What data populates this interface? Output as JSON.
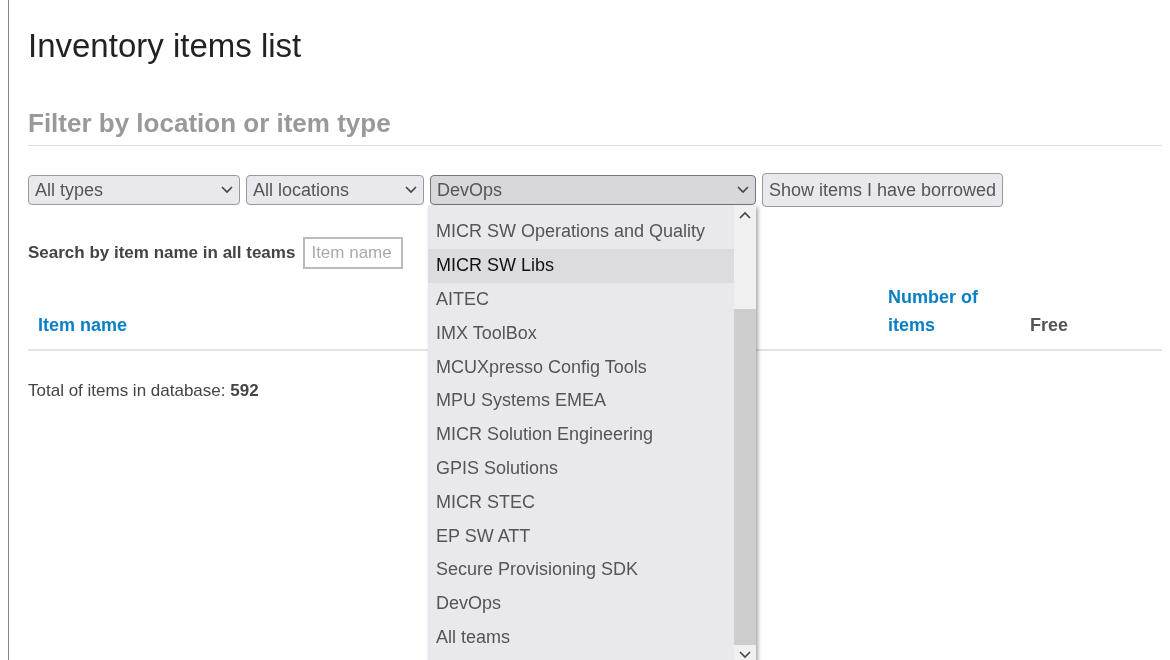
{
  "title": "Inventory items list",
  "filter_heading": "Filter by location or item type",
  "selects": [
    {
      "value": "All types",
      "open": false
    },
    {
      "value": "All locations",
      "open": false
    },
    {
      "value": "DevOps",
      "open": true
    }
  ],
  "borrowed_button": "Show items I have borrowed",
  "dropdown_options": [
    {
      "label": "MICR SW Operations and Quality",
      "selected": false
    },
    {
      "label": "MICR SW Libs",
      "selected": true
    },
    {
      "label": "AITEC",
      "selected": false
    },
    {
      "label": "IMX ToolBox",
      "selected": false
    },
    {
      "label": "MCUXpresso Config Tools",
      "selected": false
    },
    {
      "label": "MPU Systems EMEA",
      "selected": false
    },
    {
      "label": "MICR Solution Engineering",
      "selected": false
    },
    {
      "label": "GPIS Solutions",
      "selected": false
    },
    {
      "label": "MICR STEC",
      "selected": false
    },
    {
      "label": "EP SW ATT",
      "selected": false
    },
    {
      "label": "Secure Provisioning SDK",
      "selected": false
    },
    {
      "label": "DevOps",
      "selected": false
    },
    {
      "label": "All teams",
      "selected": false
    }
  ],
  "search": {
    "label": "Search by item name in all teams",
    "placeholder": "Item name"
  },
  "table": {
    "columns": [
      {
        "label": "Item name",
        "sortable": true
      },
      {
        "label": "Number of items",
        "sortable": true
      },
      {
        "label": "Free",
        "sortable": false
      }
    ]
  },
  "total": "Total of items in database: **592**"
}
